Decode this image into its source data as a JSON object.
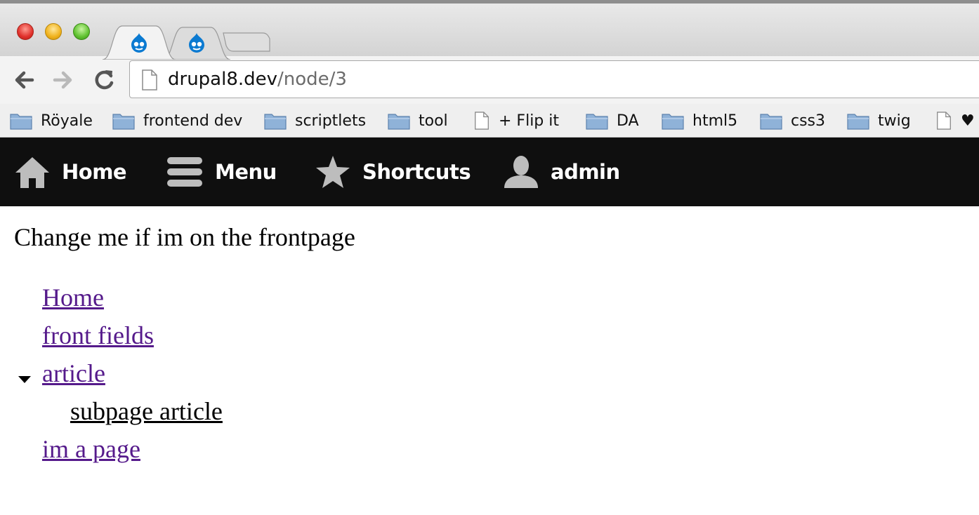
{
  "browser": {
    "tabs": [
      {
        "name": "drupal-tab-active",
        "icon": "drupal-favicon"
      },
      {
        "name": "drupal-tab",
        "icon": "drupal-favicon"
      },
      {
        "name": "new-tab",
        "icon": ""
      }
    ],
    "address": {
      "domain": "drupal8.dev",
      "path": "/node/3"
    },
    "bookmarks": [
      {
        "label": "Röyale",
        "icon": "folder-icon"
      },
      {
        "label": "frontend dev",
        "icon": "folder-icon"
      },
      {
        "label": "scriptlets",
        "icon": "folder-icon"
      },
      {
        "label": "tool",
        "icon": "folder-icon"
      },
      {
        "label": "+ Flip it",
        "icon": "page-icon"
      },
      {
        "label": "DA",
        "icon": "folder-icon"
      },
      {
        "label": "html5",
        "icon": "folder-icon"
      },
      {
        "label": "css3",
        "icon": "folder-icon"
      },
      {
        "label": "twig",
        "icon": "folder-icon"
      },
      {
        "label": "♥",
        "icon": "page-icon"
      }
    ]
  },
  "admin_toolbar": {
    "items": [
      {
        "label": "Home",
        "icon": "home-icon"
      },
      {
        "label": "Menu",
        "icon": "hamburger-icon"
      },
      {
        "label": "Shortcuts",
        "icon": "star-icon"
      },
      {
        "label": "admin",
        "icon": "user-icon"
      }
    ]
  },
  "page": {
    "intro": "Change me if im on the frontpage",
    "menu": [
      {
        "label": "Home",
        "level": 1,
        "expanded": false
      },
      {
        "label": "front fields",
        "level": 1,
        "expanded": false
      },
      {
        "label": "article",
        "level": 1,
        "expanded": true
      },
      {
        "label": "subpage article",
        "level": 2,
        "expanded": false
      },
      {
        "label": "im a page",
        "level": 1,
        "expanded": false
      }
    ]
  },
  "colors": {
    "link": "#551a8b",
    "admin_bar": "#0f0f0f",
    "drupal_blue": "#0b7ad1"
  }
}
